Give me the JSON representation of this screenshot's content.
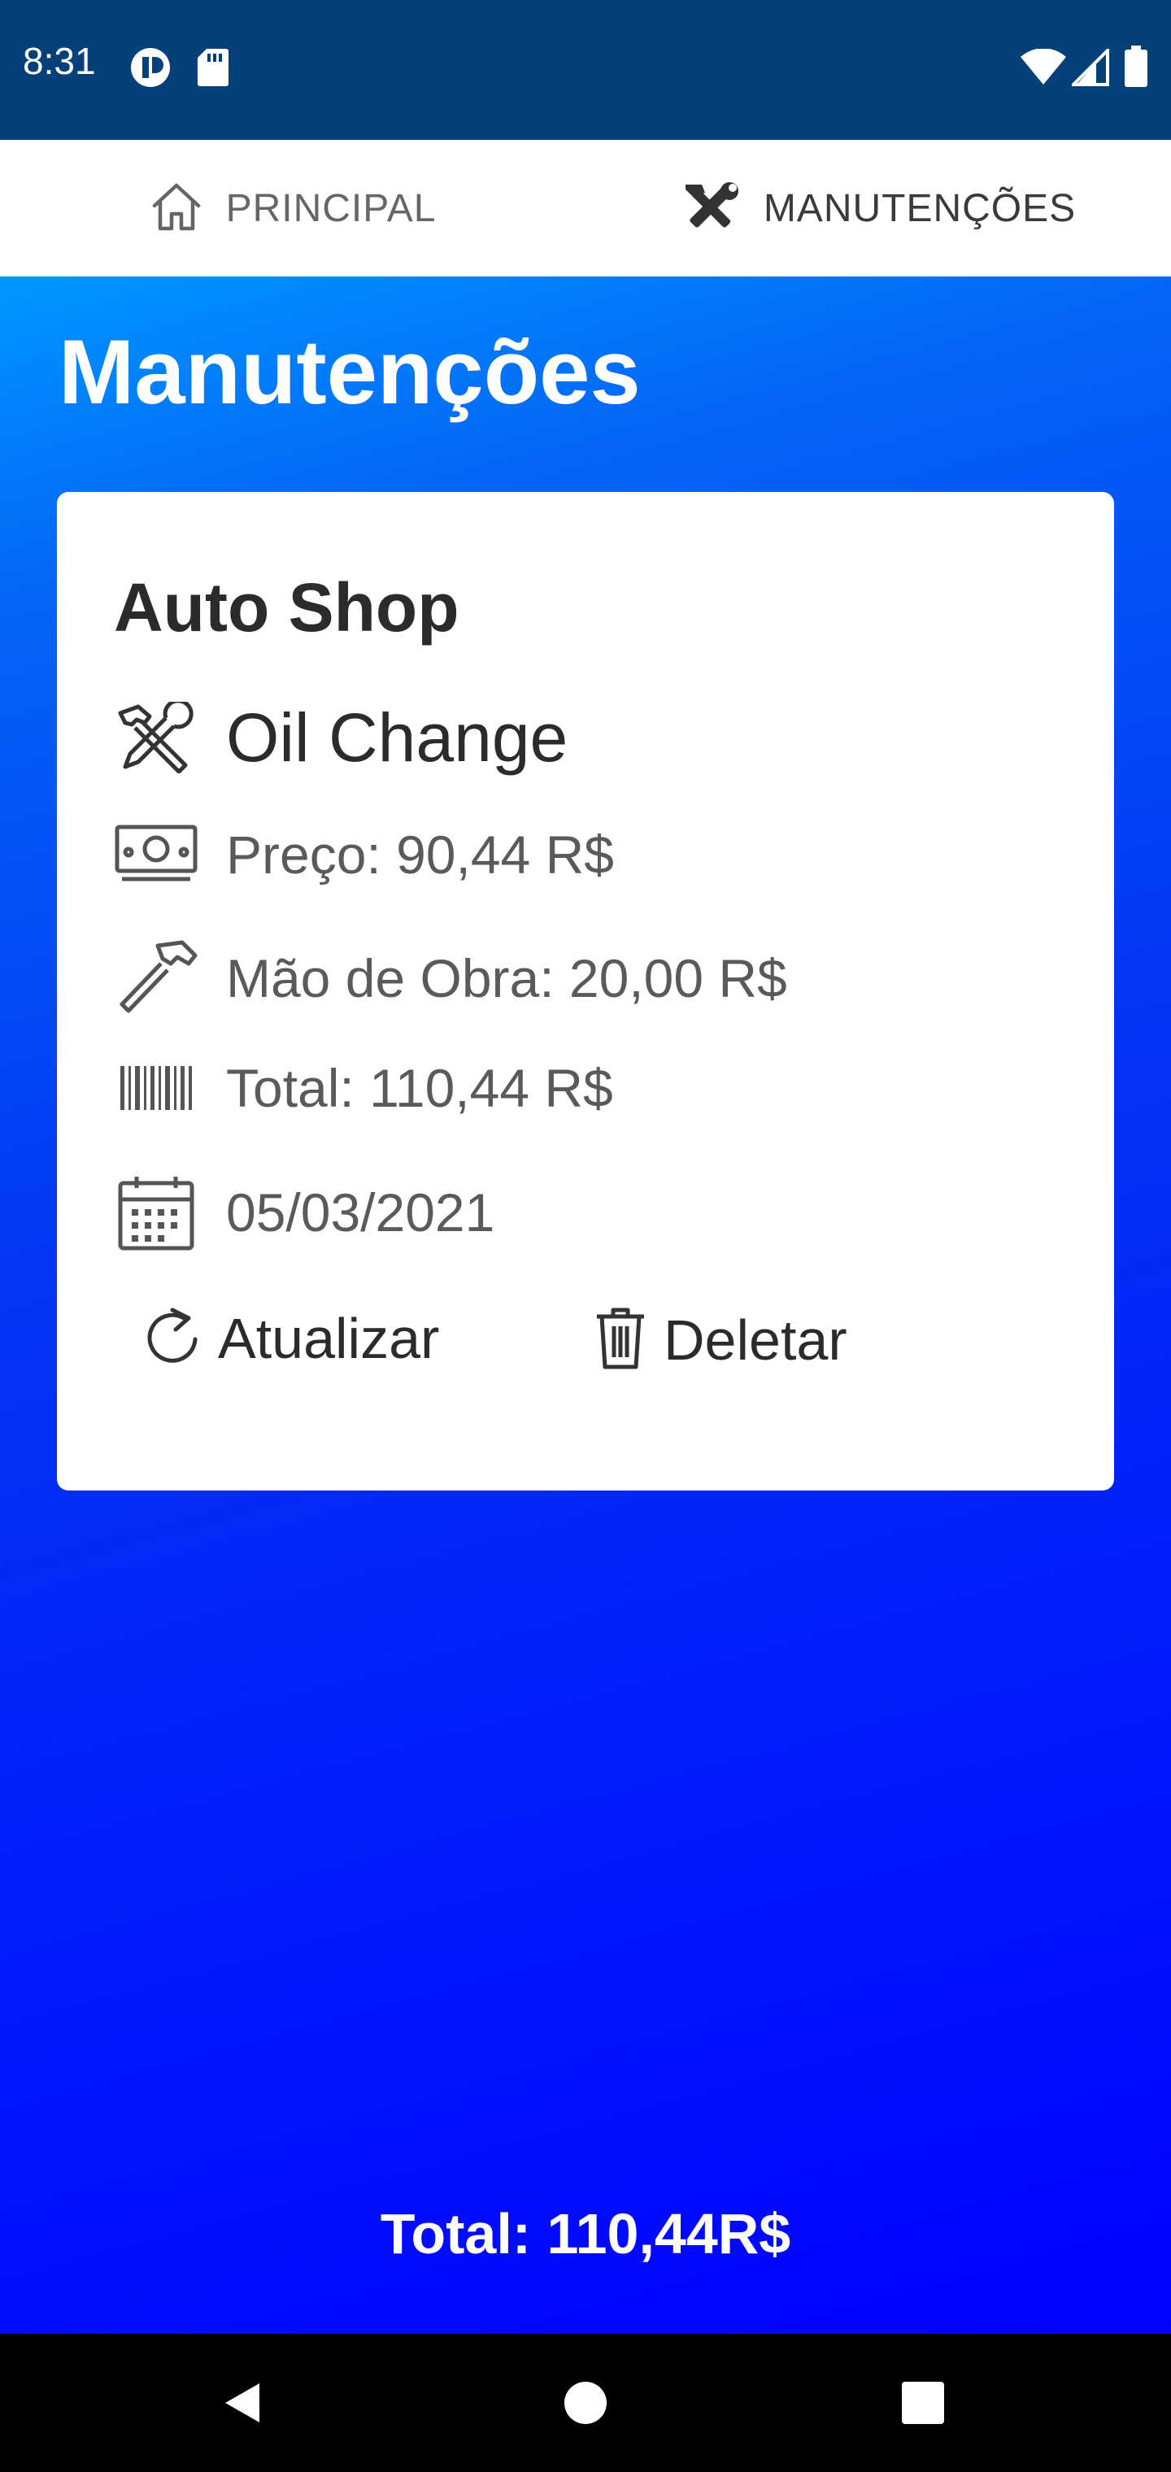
{
  "status_bar": {
    "time": "8:31",
    "icons": [
      "app-notification-icon",
      "sd-card-icon",
      "wifi-icon",
      "cell-signal-icon",
      "battery-icon"
    ]
  },
  "tabs": [
    {
      "label": "PRINCIPAL",
      "icon": "home-icon",
      "selected": false
    },
    {
      "label": "MANUTENÇÕES",
      "icon": "tools-icon",
      "selected": true
    }
  ],
  "page": {
    "title": "Manutenções"
  },
  "maintenance_card": {
    "shop": "Auto Shop",
    "service": "Oil Change",
    "price": "Preço: 90,44 R$",
    "labor": "Mão de Obra: 20,00 R$",
    "total": "Total: 110,44 R$",
    "date": "05/03/2021",
    "update_label": "Atualizar",
    "delete_label": "Deletar"
  },
  "footer": {
    "total": "Total: 110,44R$"
  },
  "colors": {
    "status_bar": "#05407a",
    "tab_indicator": "#0a6cf0",
    "gradient_top": "#0097ff",
    "gradient_bottom": "#0000ff",
    "card": "#ffffff"
  }
}
